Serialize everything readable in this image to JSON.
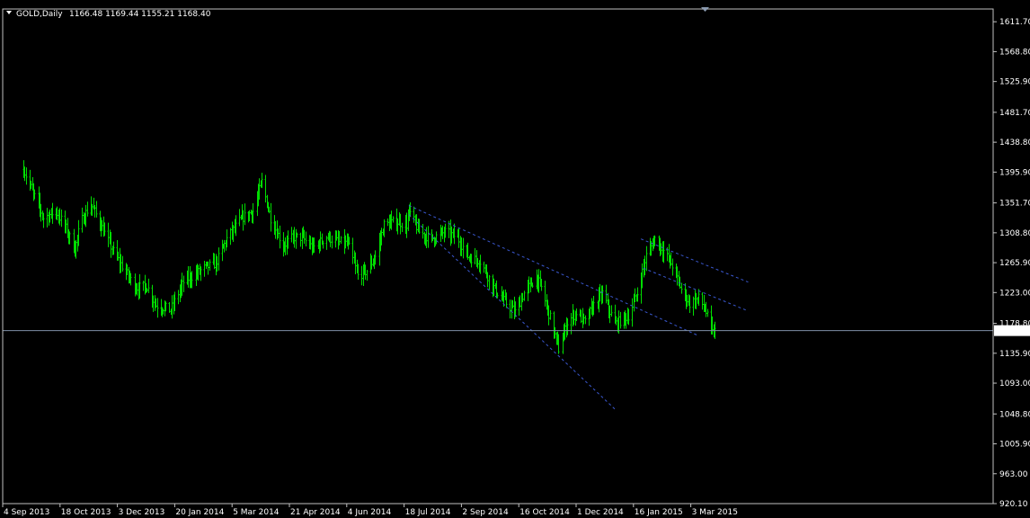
{
  "window": {
    "symbol_label": "GOLD,Daily",
    "ohlc_label": "1166.48 1169.44 1155.21 1168.40",
    "menu_icon": "triangle-down-icon",
    "shift_marker_icon": "triangle-down-icon"
  },
  "colors": {
    "background": "#000000",
    "frame": "#c0c0c0",
    "bar": "#00dd00",
    "price_line": "#7f8fa6",
    "price_label_bg": "#ffffff",
    "trendline": "#3a58d0",
    "text": "#ffffff"
  },
  "chart_data": {
    "type": "ohlc",
    "symbol": "GOLD",
    "timeframe": "Daily",
    "ylim": [
      920.1,
      1630.0
    ],
    "y_ticks": [
      "1611.70",
      "1568.80",
      "1525.90",
      "1481.70",
      "1438.80",
      "1395.90",
      "1351.70",
      "1308.80",
      "1265.90",
      "1223.00",
      "1178.80",
      "1135.90",
      "1093.00",
      "1048.80",
      "1005.90",
      "963.00",
      "920.10"
    ],
    "x_ticks": [
      "4 Sep 2013",
      "18 Oct 2013",
      "3 Dec 2013",
      "20 Jan 2014",
      "5 Mar 2014",
      "21 Apr 2014",
      "4 Jun 2014",
      "18 Jul 2014",
      "2 Sep 2014",
      "16 Oct 2014",
      "1 Dec 2014",
      "16 Jan 2015",
      "3 Mar 2015"
    ],
    "x_start": "2013-09-04",
    "x_end": "2015-03-12",
    "current_price": "1168.40",
    "current_price_value": 1168.4,
    "anchors": [
      [
        "2013-09-04",
        1400
      ],
      [
        "2013-09-12",
        1365
      ],
      [
        "2013-09-20",
        1330
      ],
      [
        "2013-09-30",
        1340
      ],
      [
        "2013-10-08",
        1315
      ],
      [
        "2013-10-15",
        1285
      ],
      [
        "2013-10-20",
        1325
      ],
      [
        "2013-10-28",
        1350
      ],
      [
        "2013-11-05",
        1320
      ],
      [
        "2013-11-14",
        1285
      ],
      [
        "2013-11-24",
        1255
      ],
      [
        "2013-12-03",
        1230
      ],
      [
        "2013-12-12",
        1232
      ],
      [
        "2013-12-19",
        1205
      ],
      [
        "2013-12-31",
        1198
      ],
      [
        "2014-01-10",
        1238
      ],
      [
        "2014-01-20",
        1250
      ],
      [
        "2014-01-27",
        1258
      ],
      [
        "2014-02-05",
        1265
      ],
      [
        "2014-02-14",
        1300
      ],
      [
        "2014-02-26",
        1330
      ],
      [
        "2014-03-07",
        1340
      ],
      [
        "2014-03-14",
        1382
      ],
      [
        "2014-03-21",
        1330
      ],
      [
        "2014-03-31",
        1290
      ],
      [
        "2014-04-08",
        1302
      ],
      [
        "2014-04-15",
        1302
      ],
      [
        "2014-04-24",
        1287
      ],
      [
        "2014-05-05",
        1303
      ],
      [
        "2014-05-15",
        1295
      ],
      [
        "2014-05-22",
        1293
      ],
      [
        "2014-05-30",
        1247
      ],
      [
        "2014-06-06",
        1254
      ],
      [
        "2014-06-13",
        1275
      ],
      [
        "2014-06-20",
        1320
      ],
      [
        "2014-06-30",
        1325
      ],
      [
        "2014-07-08",
        1320
      ],
      [
        "2014-07-10",
        1340
      ],
      [
        "2014-07-18",
        1310
      ],
      [
        "2014-07-28",
        1300
      ],
      [
        "2014-08-08",
        1310
      ],
      [
        "2014-08-18",
        1302
      ],
      [
        "2014-08-26",
        1275
      ],
      [
        "2014-09-05",
        1268
      ],
      [
        "2014-09-15",
        1233
      ],
      [
        "2014-09-22",
        1215
      ],
      [
        "2014-10-03",
        1195
      ],
      [
        "2014-10-10",
        1222
      ],
      [
        "2014-10-20",
        1245
      ],
      [
        "2014-10-24",
        1230
      ],
      [
        "2014-11-03",
        1168
      ],
      [
        "2014-11-07",
        1142
      ],
      [
        "2014-11-14",
        1180
      ],
      [
        "2014-11-21",
        1195
      ],
      [
        "2014-11-28",
        1180
      ],
      [
        "2014-12-05",
        1205
      ],
      [
        "2014-12-12",
        1222
      ],
      [
        "2014-12-22",
        1178
      ],
      [
        "2015-01-02",
        1190
      ],
      [
        "2015-01-09",
        1222
      ],
      [
        "2015-01-16",
        1276
      ],
      [
        "2015-01-23",
        1300
      ],
      [
        "2015-01-30",
        1283
      ],
      [
        "2015-02-06",
        1262
      ],
      [
        "2015-02-13",
        1228
      ],
      [
        "2015-02-20",
        1207
      ],
      [
        "2015-02-27",
        1215
      ],
      [
        "2015-03-04",
        1200
      ],
      [
        "2015-03-10",
        1165
      ],
      [
        "2015-03-12",
        1168
      ]
    ],
    "trendlines": [
      {
        "from": [
          "2014-07-10",
          1348
        ],
        "to": [
          "2015-02-26",
          1162
        ]
      },
      {
        "from": [
          "2014-07-10",
          1335
        ],
        "to": [
          "2014-12-22",
          1056
        ]
      },
      {
        "from": [
          "2015-01-12",
          1300
        ],
        "to": [
          "2015-04-08",
          1238
        ]
      },
      {
        "from": [
          "2015-01-14",
          1258
        ],
        "to": [
          "2015-04-06",
          1198
        ]
      }
    ]
  }
}
